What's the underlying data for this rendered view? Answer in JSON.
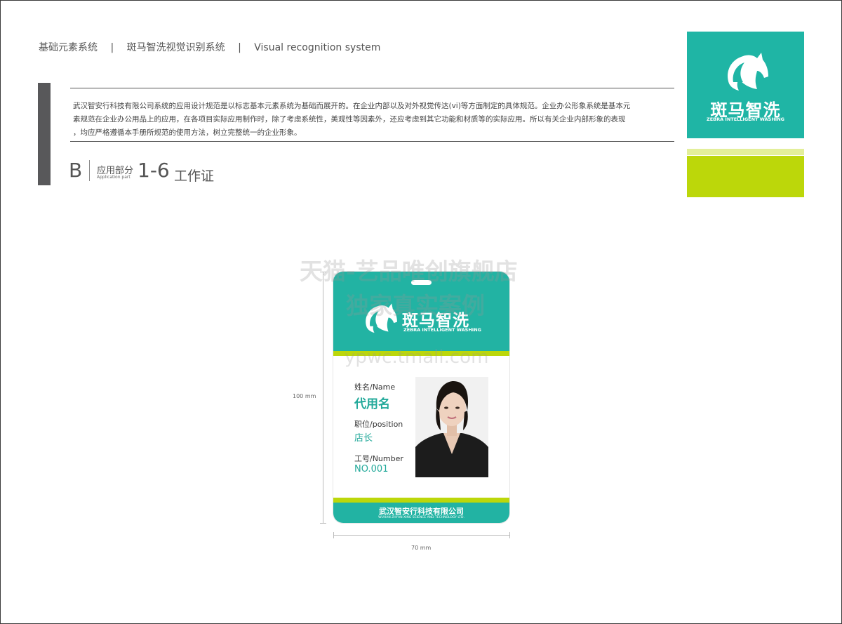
{
  "header": {
    "item1": "基础元素系统",
    "item2": "斑马智洗视觉识别系统",
    "item3": "Visual recognition system",
    "separator": "|"
  },
  "intro": {
    "line1": "武汉智安行科技有限公司系统的应用设计规范是以标志基本元素系统为基础而展开的。在企业内部以及对外视觉传达(vi)等方面制定的具体规范。企业办公形象系统是基本元",
    "line2": "素规范在企业办公用品上的应用，在各项目实际应用制作时，除了考虑系统性，美观性等因素外，还应考虑到其它功能和材质等的实际应用。所以有关企业内部形象的表现",
    "line3": "，均应严格遵循本手册所规范的使用方法，树立完整统一的企业形象。"
  },
  "section": {
    "letter": "B",
    "part_cn": "应用部分",
    "part_en": "Application part",
    "number": "1-6",
    "title": "工作证"
  },
  "brand": {
    "name_cn": "斑马智洗",
    "name_en": "ZEBRA INTELLIGENT WASHING",
    "primary_color": "#1fb5a5",
    "accent_color": "#bcd70a"
  },
  "badge": {
    "name_label": "姓名/Name",
    "name_value": "代用名",
    "position_label": "职位/position",
    "position_value": "店长",
    "number_label": "工号/Number",
    "number_value": "NO.001",
    "company_cn": "武汉智安行科技有限公司",
    "company_en": "WUHAN ZHI'AN XING SCIENCE AND TECHNOLOGY LTD."
  },
  "dimensions": {
    "height": "100 mm",
    "width": "70 mm"
  },
  "watermark": {
    "line1": "天猫-艺品唯创旗舰店",
    "line2": "独家真实案例",
    "line3": "ypwc.tmall.com"
  }
}
